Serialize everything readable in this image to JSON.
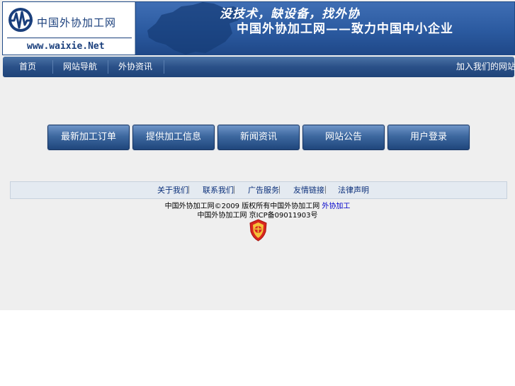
{
  "header": {
    "logo_name": "中国外协加工网",
    "logo_url": "www.waixie.Net",
    "slogan": "没技术，缺设备，找外协",
    "tagline": "中国外协加工网——致力中国中小企业"
  },
  "nav": {
    "items": [
      "首页",
      "网站导航",
      "外协资讯"
    ],
    "right_label": "加入我们的网站"
  },
  "buttons": [
    "最新加工订单",
    "提供加工信息",
    "新闻资讯",
    "网站公告",
    "用户登录"
  ],
  "footer": {
    "links": [
      "关于我们",
      "联系我们",
      "广告服务",
      "友情链接",
      "法律声明"
    ],
    "separator": "｜",
    "copyright_prefix": "中国外协加工网©2009 版权所有中国外协加工网 ",
    "copyright_link": "外协加工",
    "icp": "中国外协加工网 京ICP备09011903号"
  },
  "colors": {
    "nav_blue": "#2a5088",
    "button_blue": "#3d689f",
    "link_blue": "#0a2f7a",
    "page_bg": "#efefef"
  }
}
